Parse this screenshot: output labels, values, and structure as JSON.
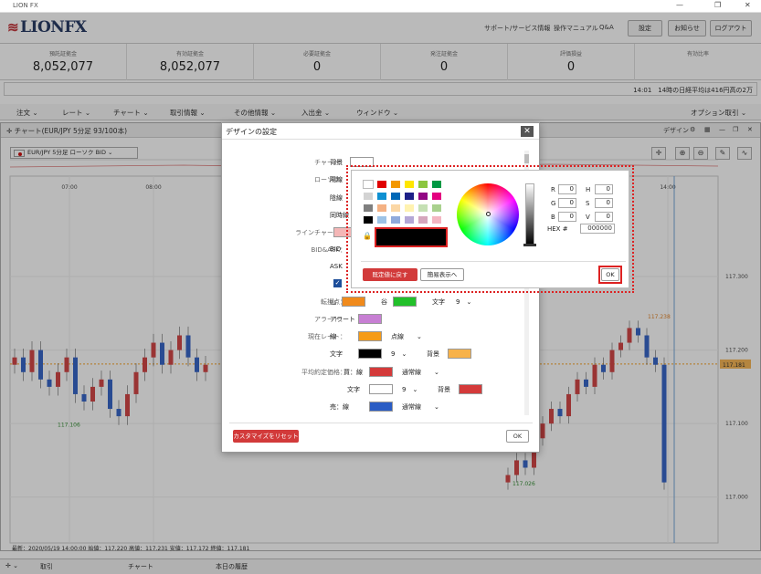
{
  "window": {
    "title": "LION FX"
  },
  "header": {
    "logo": "LIONFX",
    "links": [
      "サポート/サービス情報",
      "操作マニュアル",
      "Q&A"
    ],
    "buttons": [
      "設定",
      "お知らせ",
      "ログアウト"
    ]
  },
  "summary": [
    {
      "label": "預託証拠金",
      "value": "8,052,077"
    },
    {
      "label": "有効証拠金",
      "value": "8,052,077"
    },
    {
      "label": "必要証拠金",
      "value": "0"
    },
    {
      "label": "発注証拠金",
      "value": "0"
    },
    {
      "label": "評価損益",
      "value": "0"
    },
    {
      "label": "有効比率",
      "value": ""
    }
  ],
  "ticker": "14:01　14時の日経平均は416円高の2万",
  "menu": [
    "注文",
    "レート",
    "チャート",
    "取引情報",
    "その他情報",
    "入出金",
    "ウィンドウ",
    "オプション取引"
  ],
  "chart_window": {
    "title": "チャート(EUR/JPY 5分足 93/100本)",
    "design_label": "デザイン",
    "symbol": "EUR/JPY 5分足 ローソク BID",
    "info": "最新：2020/05/19 14:00:00 始値：117.220 高値：117.231 安値：117.172 終値：117.181"
  },
  "bottom_tabs": [
    "取引",
    "チャート",
    "本日の履歴"
  ],
  "colors": {
    "accent_red": "#d23a3a",
    "highlight": "#dd2222",
    "brand": "#1a2e5a",
    "bear": "#d03a3a",
    "bull": "#2a5cc4"
  },
  "chart_data": {
    "type": "candlestick",
    "x_ticks": [
      "07:00",
      "08:00",
      "14:00"
    ],
    "y_ticks": [
      "117.300",
      "117.200",
      "117.100",
      "117.000"
    ],
    "ylim": [
      116.95,
      117.31
    ],
    "current_price": "117.181",
    "annotations": [
      "117.106",
      "117.026",
      "117.238"
    ]
  },
  "dialog": {
    "title": "デザインの設定",
    "rows": {
      "chart": "チャート：",
      "chart_bg": "背景",
      "candle": "ローソク：",
      "candle_up": "陽線",
      "candle_down": "陰線",
      "candle_same": "同時線",
      "linechart": "ラインチャート：",
      "bidask": "BID&ASK：",
      "bid": "BID",
      "ask": "ASK",
      "pivot": "転換点：",
      "pivot_mountain": "山",
      "pivot_valley": "谷",
      "pivot_text": "文字",
      "pivot_size": "9",
      "alert": "アラート：",
      "alert_item": "アラート",
      "current": "現在レート：",
      "current_line": "線",
      "current_style": "点線",
      "current_text": "文字",
      "current_size": "9",
      "current_bg": "背景",
      "avg": "平均約定価格：",
      "avg_buy": "買：線",
      "avg_buy_style": "通常線",
      "avg_text": "文字",
      "avg_size": "9",
      "avg_bg": "背景",
      "avg_sell": "売：線",
      "avg_sell_style": "通常線"
    },
    "reset_label": "カスタマイズをリセット",
    "ok_label": "OK"
  },
  "color_picker": {
    "palette": [
      [
        "#ffffff",
        "#e00000",
        "#f39800",
        "#ffe600",
        "#8cc63f",
        "#009944"
      ],
      [
        "#d3d3d3",
        "#0e90d2",
        "#0068b7",
        "#1d2088",
        "#920783",
        "#e4007f"
      ],
      [
        "#7f7f7f",
        "#f4b183",
        "#fbd7a5",
        "#fff2b0",
        "#c5e0b4",
        "#a9d18e"
      ],
      [
        "#000000",
        "#9dc3e6",
        "#8faadc",
        "#b4a7d6",
        "#d5a6bd",
        "#f4b6c2"
      ]
    ],
    "selected_color": "#000000",
    "R_label": "R",
    "G_label": "G",
    "B_label": "B",
    "H_label": "H",
    "S_label": "S",
    "V_label": "V",
    "R": "0",
    "G": "0",
    "B": "0",
    "H": "0",
    "S": "0",
    "V": "0",
    "hex_label": "HEX #",
    "hex": "000000",
    "reset_label": "既定値に戻す",
    "simple_label": "簡易表示へ",
    "ok_label": "OK"
  }
}
